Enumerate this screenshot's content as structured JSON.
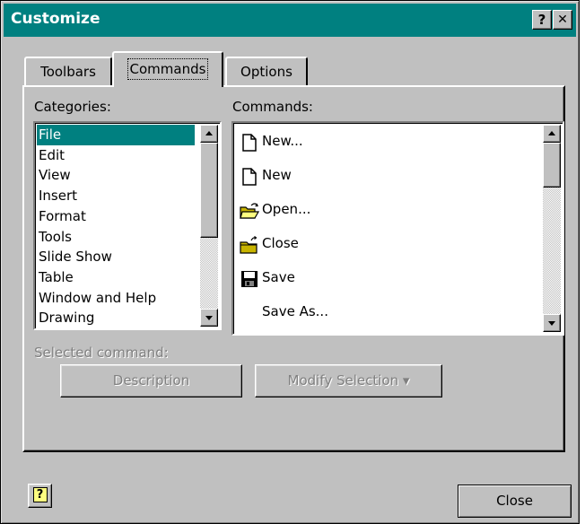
{
  "window": {
    "title": "Customize",
    "help_button": "?",
    "close_button": "✕"
  },
  "tabs": [
    {
      "label": "Toolbars",
      "active": false
    },
    {
      "label": "Commands",
      "active": true
    },
    {
      "label": "Options",
      "active": false
    }
  ],
  "categories": {
    "label": "Categories:",
    "items": [
      "File",
      "Edit",
      "View",
      "Insert",
      "Format",
      "Tools",
      "Slide Show",
      "Table",
      "Window and Help",
      "Drawing"
    ],
    "selected": "File"
  },
  "commands": {
    "label": "Commands:",
    "items": [
      {
        "label": "New...",
        "icon": "new-document-icon"
      },
      {
        "label": "New",
        "icon": "new-document-icon"
      },
      {
        "label": "Open...",
        "icon": "open-folder-icon"
      },
      {
        "label": "Close",
        "icon": "close-folder-icon"
      },
      {
        "label": "Save",
        "icon": "save-disk-icon"
      },
      {
        "label": "Save As...",
        "icon": ""
      }
    ]
  },
  "selected_command": {
    "label": "Selected command:",
    "description_button": "Description",
    "modify_button": "Modify Selection",
    "modify_arrow": "▾"
  },
  "footer": {
    "help_icon": "?",
    "close_button": "Close"
  },
  "colors": {
    "title_bar": "#008080",
    "selection": "#008080",
    "face": "#c0c0c0"
  }
}
